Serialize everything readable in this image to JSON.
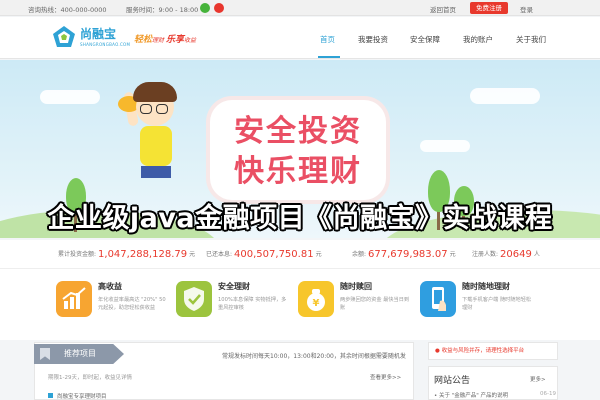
{
  "topbar": {
    "hotline": "咨询热线：400-000-0000",
    "hours": "服务时间：9:00 - 18:00",
    "home_link": "返回首页",
    "register_link": "免费注册",
    "login_link": "登录"
  },
  "header": {
    "logo_name": "尚融宝",
    "logo_sub": "SHANGRONGBAO.COM",
    "slogan": {
      "part1": "轻松",
      "part2": "理财 ",
      "part3": "乐享",
      "part4": "收益"
    },
    "nav": [
      "首页",
      "我要投资",
      "安全保障",
      "我的账户",
      "关于我们"
    ],
    "active_nav": 0
  },
  "banner": {
    "line1": "安全投资",
    "line2": "快乐理财",
    "colors": {
      "sky": "#cdeaf6",
      "board_text": "#ea4f64"
    }
  },
  "overlay_title": "企业级java金融项目《尚融宝》实战课程",
  "stats": [
    {
      "label": "累计投资金额:",
      "value": "1,047,288,128.79",
      "unit": "元"
    },
    {
      "label": "已还本息:",
      "value": "400,507,750.81",
      "unit": "元"
    },
    {
      "label": "余额:",
      "value": "677,679,983.07",
      "unit": "元"
    },
    {
      "label": "注册人数:",
      "value": "20649",
      "unit": "人"
    }
  ],
  "features": [
    {
      "title": "高收益",
      "desc": "年化收益率最高达 \"20%\" 50元起投，助您轻松获收益",
      "icon": "chart-up-icon",
      "color": "#f7a531"
    },
    {
      "title": "安全理财",
      "desc": "100%本息保障 实物抵押，多重风控审核",
      "icon": "shield-check-icon",
      "color": "#9cc43e"
    },
    {
      "title": "随时赎回",
      "desc": "两步赎回您的资金 最快当日到账",
      "icon": "money-bag-icon",
      "color": "#f7c62b"
    },
    {
      "title": "随时随地理财",
      "desc": "下载手机客户端 随时随地轻松理财",
      "icon": "mobile-icon",
      "color": "#2f9ee0"
    }
  ],
  "recommend": {
    "tab": "推荐项目",
    "notice": "常规发标时间每天10:00，13:00和20:00，其余时间根据需要随机发",
    "row1": "期限1-29天，即时起，收益见详情",
    "more": "查看更多>>",
    "row2": "尚融宝专享理财项目"
  },
  "sidebar": {
    "risk": "收益与风险并存，请理性选择平台",
    "news_title": "网站公告",
    "news_more": "更多>",
    "news_item": "• 关于 \"金融产品\" 产品的说明",
    "news_date": "06-19"
  }
}
